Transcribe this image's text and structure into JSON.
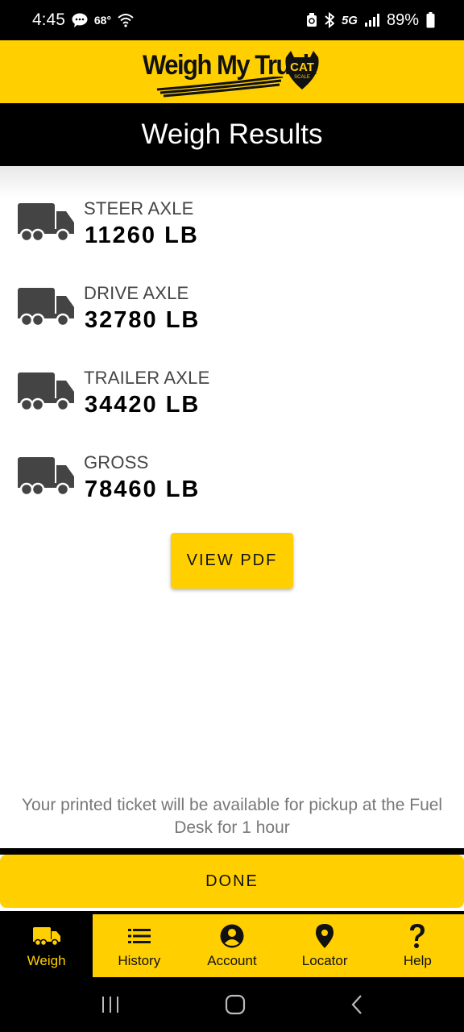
{
  "status_bar": {
    "time": "4:45",
    "temperature": "68°",
    "network": "5G",
    "battery": "89%"
  },
  "brand": {
    "logo_text": "Weigh My Truck",
    "badge_text": "CAT",
    "badge_subtext": "SCALE"
  },
  "header": {
    "title": "Weigh Results"
  },
  "results": [
    {
      "label": "STEER AXLE",
      "value": "11260 LB"
    },
    {
      "label": "DRIVE AXLE",
      "value": "32780 LB"
    },
    {
      "label": "TRAILER AXLE",
      "value": "34420 LB"
    },
    {
      "label": "GROSS",
      "value": "78460 LB"
    }
  ],
  "view_pdf_label": "VIEW PDF",
  "pickup_message": "Your printed ticket will be available for pickup at the Fuel Desk for 1 hour",
  "done_label": "DONE",
  "bottom_nav": [
    {
      "label": "Weigh",
      "icon": "truck-icon",
      "active": true
    },
    {
      "label": "History",
      "icon": "list-icon",
      "active": false
    },
    {
      "label": "Account",
      "icon": "account-circle-icon",
      "active": false
    },
    {
      "label": "Locator",
      "icon": "location-pin-icon",
      "active": false
    },
    {
      "label": "Help",
      "icon": "question-mark-icon",
      "active": false
    }
  ],
  "colors": {
    "brand_yellow": "#ffcf00",
    "black": "#000000",
    "icon_gray": "#444444"
  }
}
